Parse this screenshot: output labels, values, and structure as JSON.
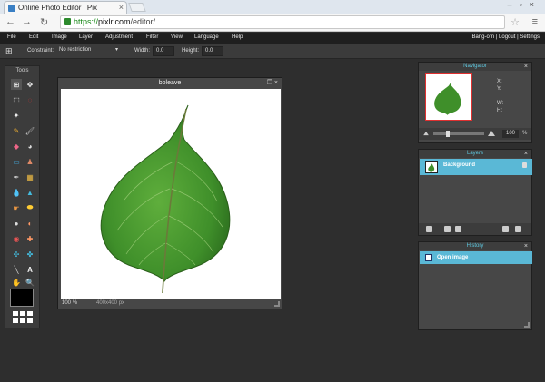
{
  "browser": {
    "tab_title": "Online Photo Editor | Pix",
    "url_scheme": "https://",
    "url_host": "pixlr.com",
    "url_path": "/editor/"
  },
  "menubar": {
    "items": [
      "File",
      "Edit",
      "Image",
      "Layer",
      "Adjustment",
      "Filter",
      "View",
      "Language",
      "Help"
    ],
    "user": "Bang-orn",
    "logout": "Logout",
    "settings": "Settings"
  },
  "options": {
    "constraint_label": "Constraint:",
    "constraint_value": "No restriction",
    "width_label": "Width:",
    "width_value": "0.0",
    "height_label": "Height:",
    "height_value": "0.0"
  },
  "tools": {
    "title": "Tools"
  },
  "document": {
    "title": "boleave",
    "zoom": "100",
    "zoom_unit": "%",
    "size": "400x400 px"
  },
  "navigator": {
    "title": "Navigator",
    "x_label": "X:",
    "y_label": "Y:",
    "w_label": "W:",
    "h_label": "H:",
    "zoom": "100",
    "zoom_unit": "%"
  },
  "layers": {
    "title": "Layers",
    "items": [
      {
        "name": "Background"
      }
    ]
  },
  "history": {
    "title": "History",
    "items": [
      {
        "name": "Open image"
      }
    ]
  },
  "colors": {
    "accent": "#5ab8d6",
    "panel": "#474747",
    "leaf": "#3f8f2a"
  }
}
